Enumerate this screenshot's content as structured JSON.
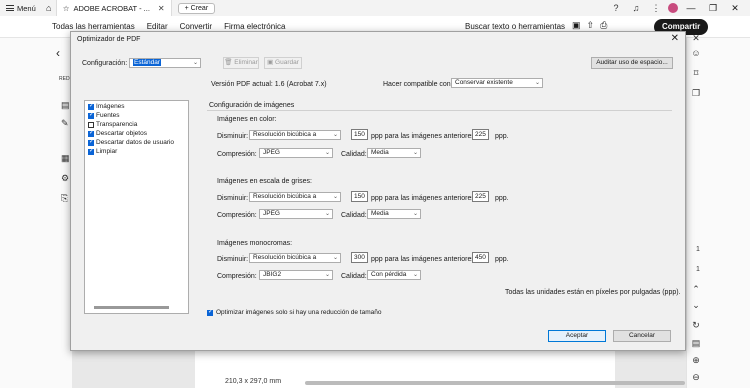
{
  "titlebar": {
    "menu_label": "Menú",
    "tab_label": "ADOBE ACROBAT - ...",
    "new_tab_label": "Crear"
  },
  "menubar": {
    "items": [
      "Todas las herramientas",
      "Editar",
      "Convertir",
      "Firma electrónica"
    ],
    "search_tools": "Buscar texto o herramientas",
    "share_label": "Compartir"
  },
  "background": {
    "page_size": "210,3 x 297,0 mm",
    "page_num_top": "1",
    "page_num_bottom": "1",
    "left_rail_label": "REDI"
  },
  "dialog": {
    "title": "Optimizador de PDF",
    "config_label": "Configuración:",
    "config_value": "Estándar",
    "delete_label": "Eliminar",
    "save_label": "Guardar",
    "audit_label": "Auditar uso de espacio...",
    "version_label": "Versión PDF actual: 1.6 (Acrobat 7.x)",
    "compat_label": "Hacer compatible con:",
    "compat_value": "Conservar existente",
    "list_items": [
      {
        "label": "Imágenes",
        "checked": true
      },
      {
        "label": "Fuentes",
        "checked": true
      },
      {
        "label": "Transparencia",
        "checked": false
      },
      {
        "label": "Descartar objetos",
        "checked": true
      },
      {
        "label": "Descartar datos de usuario",
        "checked": true
      },
      {
        "label": "Limpiar",
        "checked": true
      }
    ],
    "image_config_title": "Configuración de imágenes",
    "downsample_label": "Disminuir:",
    "compression_label": "Compresión:",
    "quality_label": "Calidad:",
    "ppi_for_label": "ppp para las imágenes anteriores",
    "ppi_unit": "ppp.",
    "color": {
      "title": "Imágenes en color:",
      "method": "Resolución bicúbica a",
      "ppi": "150",
      "above": "225",
      "compression": "JPEG",
      "quality": "Media"
    },
    "gray": {
      "title": "Imágenes en escala de grises:",
      "method": "Resolución bicúbica a",
      "ppi": "150",
      "above": "225",
      "compression": "JPEG",
      "quality": "Media"
    },
    "mono": {
      "title": "Imágenes monocromas:",
      "method": "Resolución bicúbica a",
      "ppi": "300",
      "above": "450",
      "compression": "JBIG2",
      "quality": "Con pérdida"
    },
    "units_note": "Todas las unidades están en píxeles por pulgadas (ppp).",
    "optimize_only_label": "Optimizar imágenes solo si hay una reducción de tamaño",
    "optimize_only_checked": true,
    "accept_label": "Aceptar",
    "cancel_label": "Cancelar"
  }
}
